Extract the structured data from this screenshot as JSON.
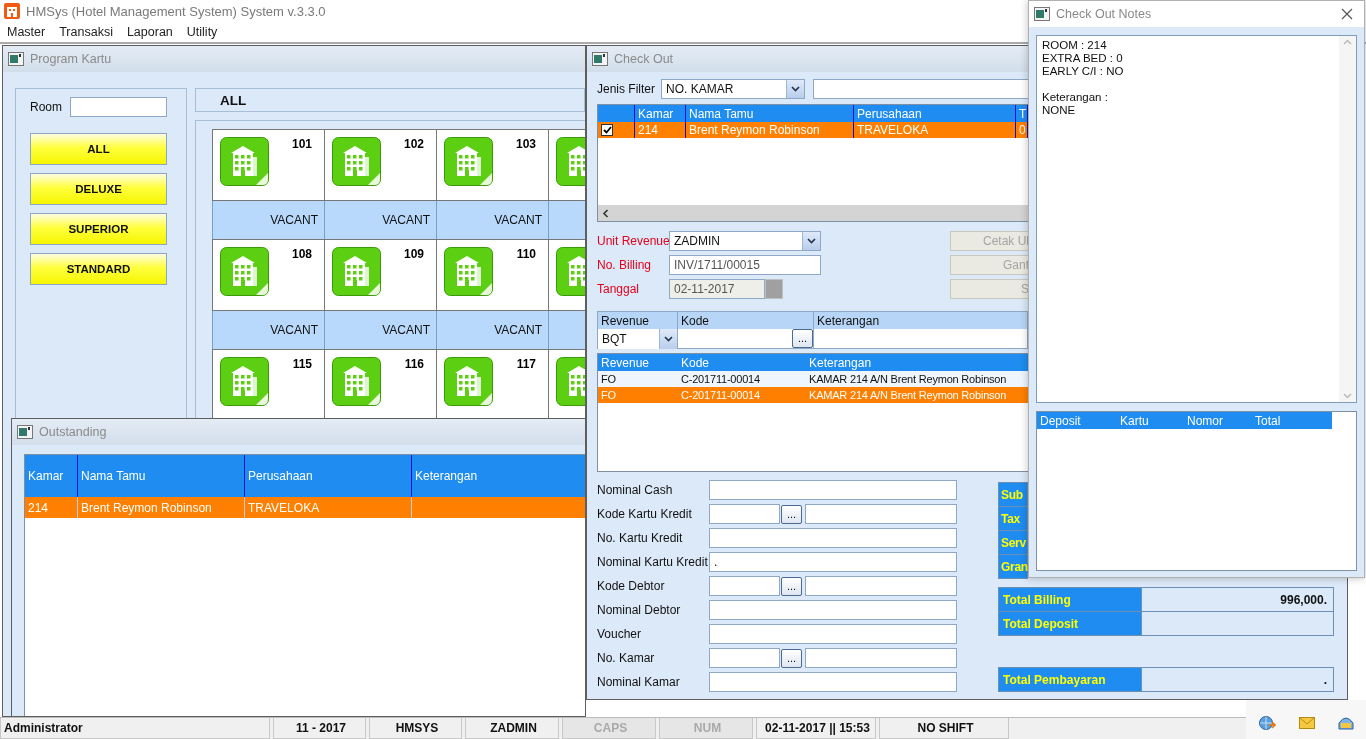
{
  "app": {
    "title": "HMSys (Hotel Management System) System v.3.3.0"
  },
  "menu": [
    "Master",
    "Transaksi",
    "Laporan",
    "Utility"
  ],
  "program_kartu": {
    "title": "Program Kartu",
    "room_label": "Room",
    "categories": [
      "ALL",
      "DELUXE",
      "SUPERIOR",
      "STANDARD"
    ],
    "header": "ALL",
    "room_rows": [
      [
        {
          "number": "101",
          "status": "VACANT"
        },
        {
          "number": "102",
          "status": "VACANT"
        },
        {
          "number": "103",
          "status": "VACANT"
        }
      ],
      [
        {
          "number": "108",
          "status": "VACANT"
        },
        {
          "number": "109",
          "status": "VACANT"
        },
        {
          "number": "110",
          "status": "VACANT"
        }
      ],
      [
        {
          "number": "115"
        },
        {
          "number": "116"
        },
        {
          "number": "117"
        }
      ]
    ]
  },
  "outstanding": {
    "title": "Outstanding",
    "columns": [
      "Kamar",
      "Nama Tamu",
      "Perusahaan",
      "Keterangan"
    ],
    "rows": [
      {
        "cells": [
          "214",
          "Brent Reymon Robinson",
          "TRAVELOKA"
        ],
        "selected": true
      }
    ]
  },
  "check_out": {
    "title": "Check Out",
    "filter": {
      "label": "Jenis Filter",
      "value": "NO. KAMAR"
    },
    "guests": {
      "columns": [
        "Kamar",
        "Nama Tamu",
        "Perusahaan",
        "T"
      ],
      "rows": [
        {
          "checked": true,
          "selected": true,
          "cells": [
            "214",
            "Brent Reymon Robinson",
            "TRAVELOKA",
            "0"
          ]
        }
      ]
    },
    "fields": [
      {
        "label": "Unit Revenue",
        "value": "ZADMIN",
        "kind": "combo"
      },
      {
        "label": "No. Billing",
        "value": "INV/1711/00015",
        "kind": "text"
      },
      {
        "label": "Tanggal",
        "value": "02-11-2017",
        "kind": "date"
      }
    ],
    "buttons": [
      {
        "label": "Cetak Ul",
        "disabled": true
      },
      {
        "label": "Gant",
        "disabled": true
      },
      {
        "label": "S",
        "disabled": true
      }
    ],
    "revenue_entry": {
      "columns": [
        "Revenue",
        "Kode",
        "Keterangan"
      ],
      "revenue": "BQT",
      "browse_label": "..."
    },
    "revenue_list": {
      "columns": [
        "Revenue",
        "Kode",
        "Keterangan"
      ],
      "rows": [
        {
          "cells": [
            "FO",
            "C-201711-00014",
            "KAMAR 214 A/N Brent Reymon Robinson"
          ],
          "selected": false
        },
        {
          "cells": [
            "FO",
            "C-201711-00014",
            "KAMAR 214 A/N Brent Reymon Robinson"
          ],
          "selected": true
        }
      ]
    },
    "payment_fields": [
      {
        "label": "Nominal Cash",
        "kind": "text"
      },
      {
        "label": "Kode Kartu Kredit",
        "kind": "lookup",
        "button": "..."
      },
      {
        "label": "No. Kartu Kredit",
        "kind": "text"
      },
      {
        "label": "Nominal Kartu Kredit",
        "kind": "text",
        "value": "."
      },
      {
        "label": "Kode Debtor",
        "kind": "lookup",
        "button": "..."
      },
      {
        "label": "Nominal Debtor",
        "kind": "text"
      },
      {
        "label": "Voucher",
        "kind": "text"
      },
      {
        "label": "No. Kamar",
        "kind": "lookup",
        "button": "..."
      },
      {
        "label": "Nominal Kamar",
        "kind": "text"
      }
    ],
    "totals_partial": [
      {
        "label": "Sub"
      },
      {
        "label": "Tax"
      },
      {
        "label": "Serv"
      },
      {
        "label": "Gran"
      }
    ],
    "totals": [
      {
        "label": "Total Billing",
        "value": "996,000."
      },
      {
        "label": "Total Deposit"
      }
    ],
    "payment_total": {
      "label": "Total Pembayaran",
      "value": "."
    }
  },
  "notes": {
    "title": "Check Out Notes",
    "text": "ROOM : 214\nEXTRA BED : 0\nEARLY C/I : NO\n\nKeterangan :\nNONE",
    "deposit_columns": [
      "Deposit",
      "Kartu",
      "Nomor",
      "Total"
    ]
  },
  "status_bar": [
    {
      "text": "Administrator",
      "enabled": true
    },
    {
      "text": "11 - 2017",
      "enabled": true
    },
    {
      "text": "HMSYS",
      "enabled": true
    },
    {
      "text": "ZADMIN",
      "enabled": true
    },
    {
      "text": "CAPS",
      "enabled": false
    },
    {
      "text": "NUM",
      "enabled": false
    },
    {
      "text": "02-11-2017 || 15:53",
      "enabled": true
    },
    {
      "text": "NO SHIFT",
      "enabled": true
    }
  ]
}
